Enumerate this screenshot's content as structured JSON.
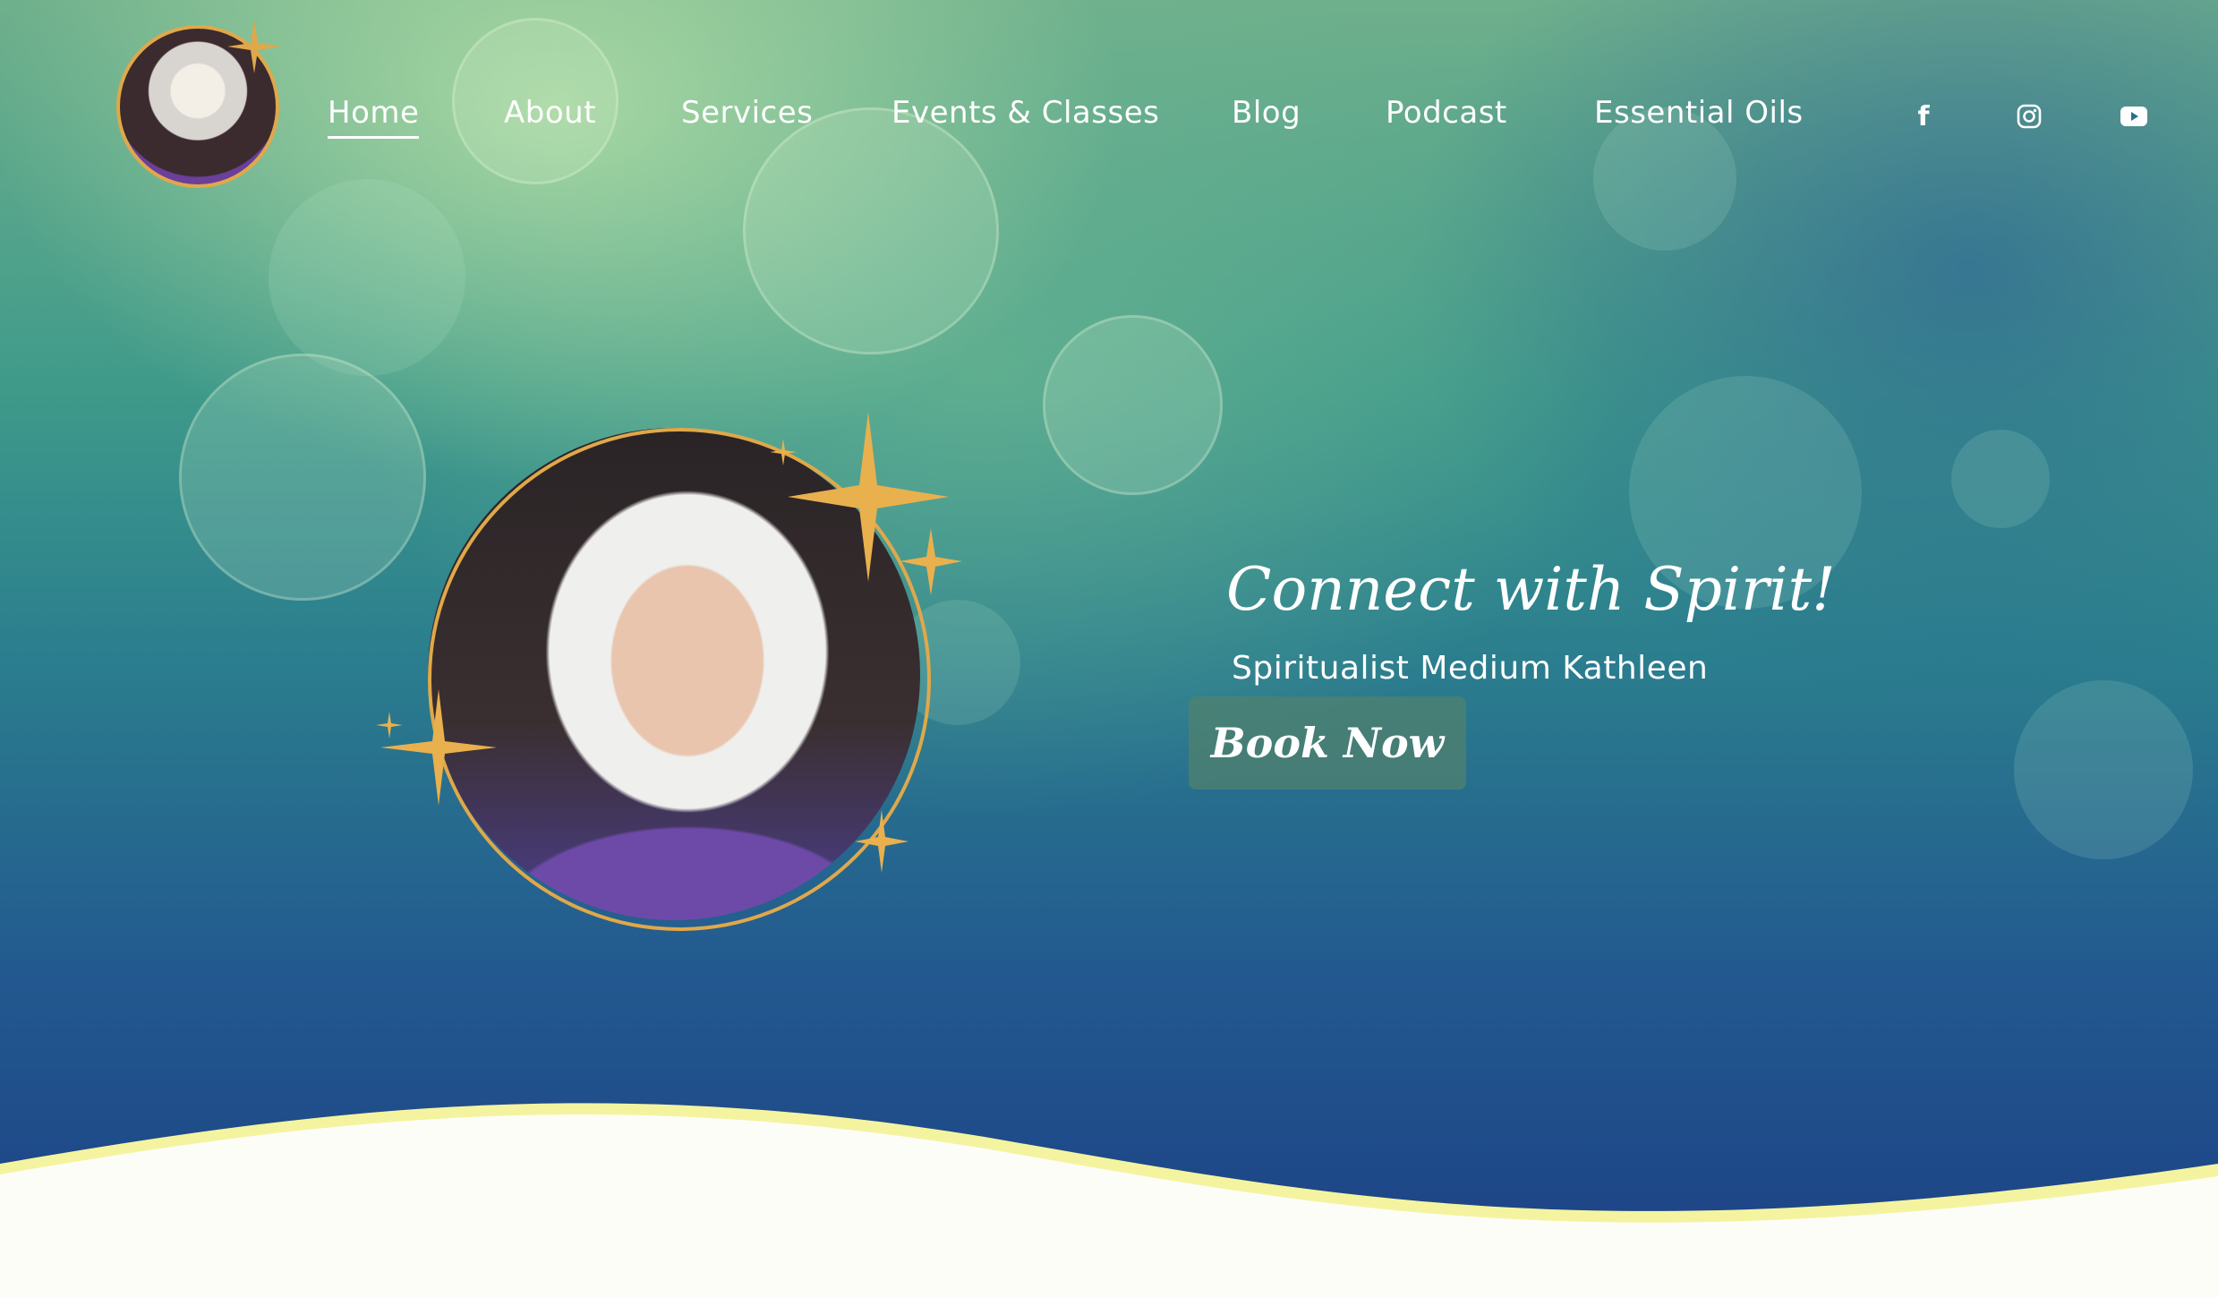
{
  "nav": {
    "items": [
      {
        "label": "Home",
        "active": true
      },
      {
        "label": "About"
      },
      {
        "label": "Services"
      },
      {
        "label": "Events & Classes"
      },
      {
        "label": "Blog"
      },
      {
        "label": "Podcast"
      },
      {
        "label": "Essential Oils"
      }
    ]
  },
  "social": {
    "facebook": {
      "glyph": "f",
      "icon": "facebook-icon"
    },
    "instagram": {
      "icon": "instagram-icon"
    },
    "youtube": {
      "icon": "youtube-icon"
    }
  },
  "hero": {
    "tagline": "Connect with Spirit!",
    "subtitle": "Spiritualist Medium Kathleen",
    "button_label": "Book Now"
  },
  "colors": {
    "accent_gold": "#e0a84a",
    "wave_border": "#f4f4a0",
    "page_bg": "#fdfdf8"
  }
}
